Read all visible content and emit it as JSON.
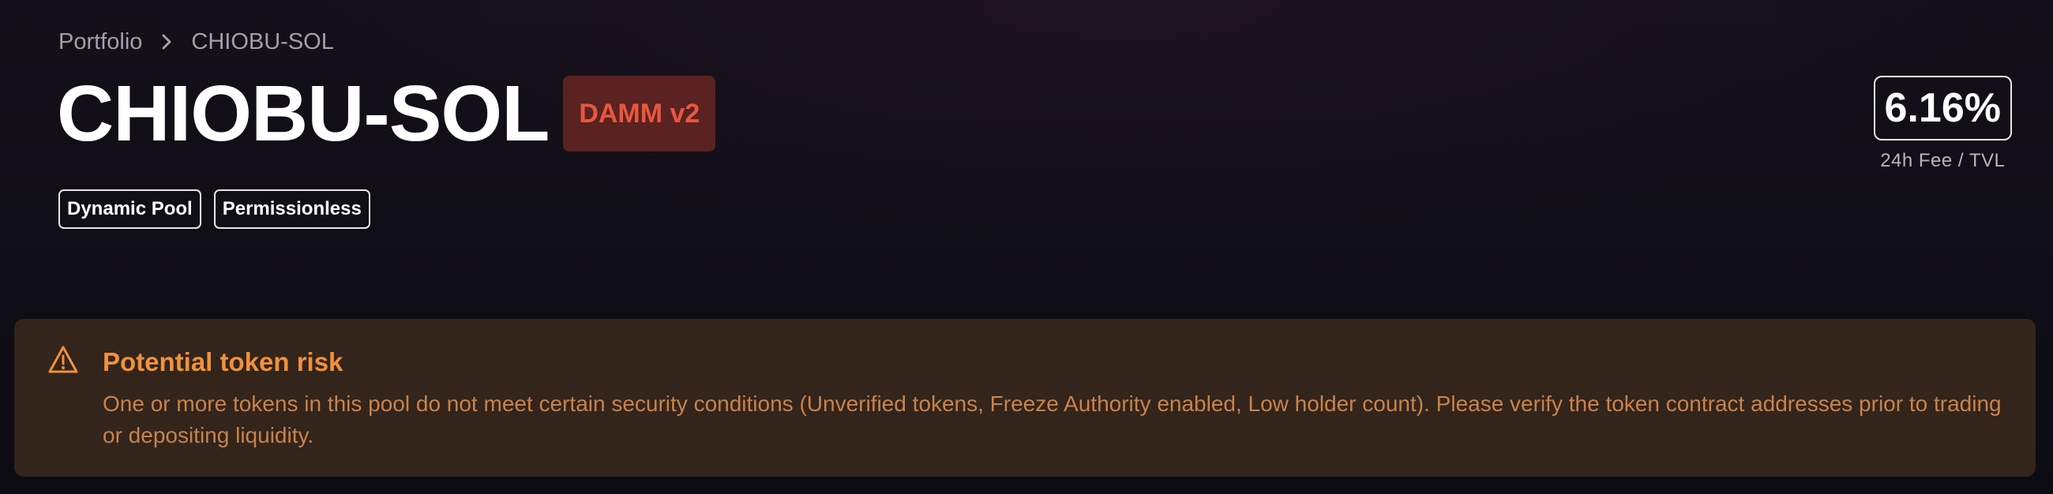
{
  "breadcrumb": {
    "root": "Portfolio",
    "current": "CHIOBU-SOL",
    "separator_icon": "chevron-right"
  },
  "pool": {
    "title": "CHIOBU-SOL",
    "version_badge": "DAMM v2",
    "tags": [
      "Dynamic Pool",
      "Permissionless"
    ]
  },
  "metric": {
    "value": "6.16%",
    "label": "24h Fee / TVL"
  },
  "warning": {
    "icon": "warning-triangle",
    "title": "Potential token risk",
    "message": "One or more tokens in this pool do not meet certain security conditions (Unverified tokens, Freeze Authority enabled, Low holder count). Please verify the token contract addresses prior to trading or depositing liquidity."
  },
  "colors": {
    "background": "#110e16",
    "badge_bg": "#5a2220",
    "badge_text": "#e8573f",
    "warning_bg": "#33241c",
    "warning_title": "#f0913d",
    "warning_text": "#c9834a",
    "muted_text": "#a3a0ab"
  }
}
